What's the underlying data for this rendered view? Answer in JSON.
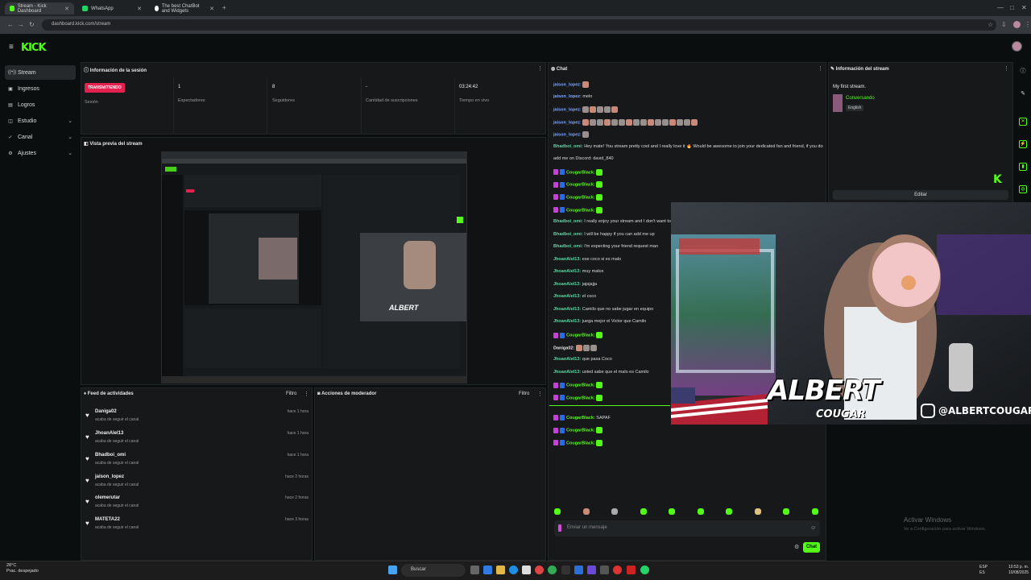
{
  "browser": {
    "tabs": [
      {
        "label": "Stream - Kick Dashboard",
        "fav": "#53fc18"
      },
      {
        "label": "WhatsApp",
        "fav": "#25d366"
      },
      {
        "label": "The best ChatBot and Widgets",
        "fav": "#ffffff"
      }
    ],
    "url": "dashboard.kick.com/stream"
  },
  "header": {
    "logo": "KICK"
  },
  "sidebar": {
    "items": [
      {
        "label": "Stream",
        "icon": "broadcast-icon"
      },
      {
        "label": "Ingresos",
        "icon": "money-icon"
      },
      {
        "label": "Logros",
        "icon": "trophy-icon"
      },
      {
        "label": "Estudio",
        "icon": "studio-icon"
      },
      {
        "label": "Canal",
        "icon": "channel-icon"
      },
      {
        "label": "Ajustes",
        "icon": "gear-icon"
      }
    ]
  },
  "session": {
    "title": "Información de la sesión",
    "badge": "TRANSMITIENDO",
    "badge_label": "Sesión",
    "stats": [
      {
        "value": "1",
        "label": "Espectadores"
      },
      {
        "value": "8",
        "label": "Seguidores"
      },
      {
        "value": "-",
        "label": "Cantidad de suscripciones"
      },
      {
        "value": "03:24:42",
        "label": "Tiempo en vivo"
      }
    ]
  },
  "preview": {
    "title": "Vista previa del stream"
  },
  "feed": {
    "title": "Feed de actividades",
    "filter": "Filtro",
    "items": [
      {
        "name": "Daniga02",
        "sub": "acaba de seguir el canal",
        "time": "hace 1 hora"
      },
      {
        "name": "JhoanAlel13",
        "sub": "acaba de seguir el canal",
        "time": "hace 1 hora"
      },
      {
        "name": "Bhadboi_omi",
        "sub": "acaba de seguir el canal",
        "time": "hace 1 hora"
      },
      {
        "name": "jaison_lopez",
        "sub": "acaba de seguir el canal",
        "time": "hace 2 horas"
      },
      {
        "name": "olemerutar",
        "sub": "acaba de seguir el canal",
        "time": "hace 2 horas"
      },
      {
        "name": "MATETA22",
        "sub": "acaba de seguir el canal",
        "time": "hace 3 horas"
      }
    ]
  },
  "mod": {
    "title": "Acciones de moderador",
    "filter": "Filtro"
  },
  "chat": {
    "title": "Chat",
    "messages": [
      {
        "user": "jaison_lopez:",
        "text": "",
        "color": "#7fa7ff",
        "emotes": 1,
        "badges": 0
      },
      {
        "user": "jaison_lopez:",
        "text": "melo",
        "color": "#7fa7ff",
        "emotes": 0,
        "badges": 0
      },
      {
        "user": "jaison_lopez:",
        "text": "",
        "color": "#7fa7ff",
        "emotes": 5,
        "badges": 0
      },
      {
        "user": "jaison_lopez:",
        "text": "",
        "color": "#7fa7ff",
        "emotes": 16,
        "badges": 0
      },
      {
        "user": "jaison_lopez:",
        "text": "",
        "color": "#7fa7ff",
        "emotes": 1,
        "badges": 0
      },
      {
        "user": "Bhadboi_omi:",
        "text": "Hey mate! You stream pretty cool and I really love it 🔥 Would be awesome to join your dedicated fan and friend, if you don't mind",
        "color": "#5fd4a6",
        "emotes": 0,
        "badges": 0
      },
      {
        "user": "",
        "text": "add me on Discord: david_840",
        "color": "#5fd4a6",
        "emotes": 0,
        "badges": 0
      },
      {
        "user": "CougarBlack:",
        "text": "",
        "color": "#53fc18",
        "emotes": 1,
        "badges": 2
      },
      {
        "user": "CougarBlack:",
        "text": "",
        "color": "#53fc18",
        "emotes": 1,
        "badges": 2
      },
      {
        "user": "CougarBlack:",
        "text": "",
        "color": "#53fc18",
        "emotes": 1,
        "badges": 2
      },
      {
        "user": "CougarBlack:",
        "text": "",
        "color": "#53fc18",
        "emotes": 1,
        "badges": 2
      },
      {
        "user": "Bhadboi_omi:",
        "text": "I really enjoy your stream and I don't want to miss",
        "color": "#5fd4a6",
        "emotes": 0,
        "badges": 0
      },
      {
        "user": "Bhadboi_omi:",
        "text": "I will be happy if you can add me up",
        "color": "#5fd4a6",
        "emotes": 0,
        "badges": 0
      },
      {
        "user": "Bhadboi_omi:",
        "text": "I'm expecting your friend request man",
        "color": "#5fd4a6",
        "emotes": 0,
        "badges": 0
      },
      {
        "user": "JhoanAlel13:",
        "text": "ese coco si es malo",
        "color": "#5fd4a6",
        "emotes": 0,
        "badges": 0
      },
      {
        "user": "JhoanAlel13:",
        "text": "muy malos",
        "color": "#5fd4a6",
        "emotes": 0,
        "badges": 0
      },
      {
        "user": "JhoanAlel13:",
        "text": "jajajajja",
        "color": "#5fd4a6",
        "emotes": 0,
        "badges": 0
      },
      {
        "user": "JhoanAlel13:",
        "text": "el coco",
        "color": "#5fd4a6",
        "emotes": 0,
        "badges": 0
      },
      {
        "user": "JhoanAlel13:",
        "text": "Camilo que no sabe jugar en equipo",
        "color": "#5fd4a6",
        "emotes": 0,
        "badges": 0
      },
      {
        "user": "JhoanAlel13:",
        "text": "juega mejor el Victor que Camilo",
        "color": "#5fd4a6",
        "emotes": 0,
        "badges": 0
      },
      {
        "user": "CougarBlack:",
        "text": "",
        "color": "#53fc18",
        "emotes": 1,
        "badges": 2
      },
      {
        "user": "Daniga02:",
        "text": "",
        "color": "#e6e6e6",
        "emotes": 3,
        "badges": 0
      },
      {
        "user": "JhoanAlel13:",
        "text": "que pasa Coco",
        "color": "#5fd4a6",
        "emotes": 0,
        "badges": 0
      },
      {
        "user": "JhoanAlel13:",
        "text": "usted sabe que el malo es Camilo",
        "color": "#5fd4a6",
        "emotes": 0,
        "badges": 0
      },
      {
        "user": "CougarBlack:",
        "text": "",
        "color": "#53fc18",
        "emotes": 1,
        "badges": 2
      },
      {
        "user": "CougarBlack:",
        "text": "",
        "color": "#53fc18",
        "emotes": 1,
        "badges": 2
      },
      {
        "user": "CougarBlack:",
        "text": "SAPAF",
        "color": "#53fc18",
        "emotes": 0,
        "badges": 2
      },
      {
        "user": "CougarBlack:",
        "text": "",
        "color": "#53fc18",
        "emotes": 1,
        "badges": 2
      },
      {
        "user": "CougarBlack:",
        "text": "",
        "color": "#53fc18",
        "emotes": 1,
        "badges": 2
      }
    ],
    "input_placeholder": "Enviar un mensaje",
    "send": "Chat"
  },
  "info": {
    "title": "Información del stream",
    "stream_title": "My first stream.",
    "category": "Conversando",
    "language": "English",
    "edit": "Editar"
  },
  "overlay": {
    "name": "ALBERT",
    "sub": "COUGAR",
    "handle": "@ALBERTCOUGAR08"
  },
  "windows": {
    "activate": "Activar Windows",
    "activate_sub": "Ve a Configuración para activar Windows."
  },
  "taskbar": {
    "temp": "28°C",
    "weather": "Prac. despejado",
    "search": "Buscar",
    "lang1": "ESP",
    "lang2": "ES",
    "time": "10:53 p. m.",
    "date": "10/08/2025"
  },
  "colors": {
    "accent": "#53fc18",
    "live": "#e3204e"
  }
}
